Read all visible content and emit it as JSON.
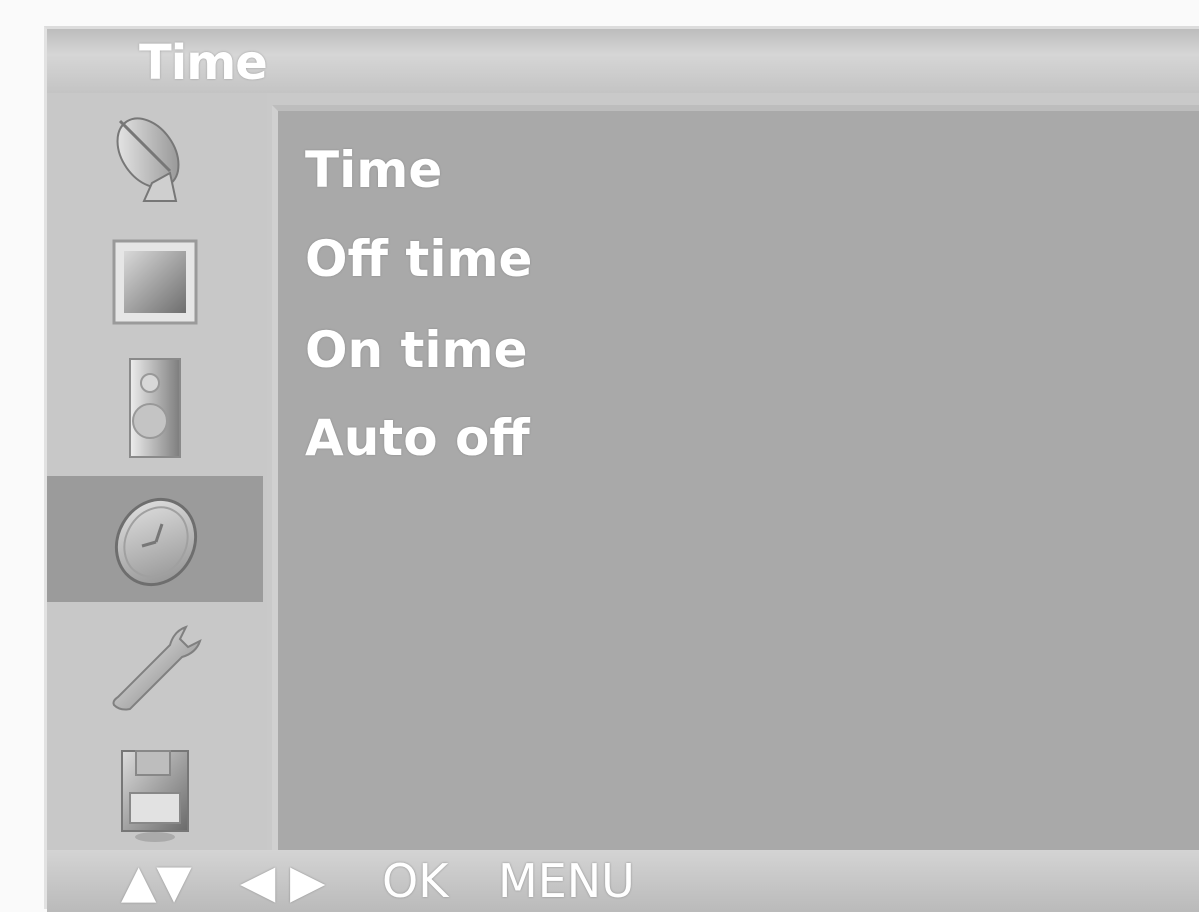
{
  "header": {
    "title": "Time"
  },
  "sidebar": {
    "items": [
      {
        "icon": "satellite-dish-icon",
        "active": false
      },
      {
        "icon": "picture-icon",
        "active": false
      },
      {
        "icon": "speaker-icon",
        "active": false
      },
      {
        "icon": "clock-icon",
        "active": true
      },
      {
        "icon": "wrench-icon",
        "active": false
      },
      {
        "icon": "save-icon",
        "active": false
      }
    ]
  },
  "menu": {
    "items": [
      {
        "label": "Time"
      },
      {
        "label": "Off time"
      },
      {
        "label": "On time"
      },
      {
        "label": "Auto off"
      }
    ]
  },
  "footer": {
    "up_down": "▲▼",
    "left_right": "◀ ▶",
    "ok": "OK",
    "menu": "MENU"
  }
}
